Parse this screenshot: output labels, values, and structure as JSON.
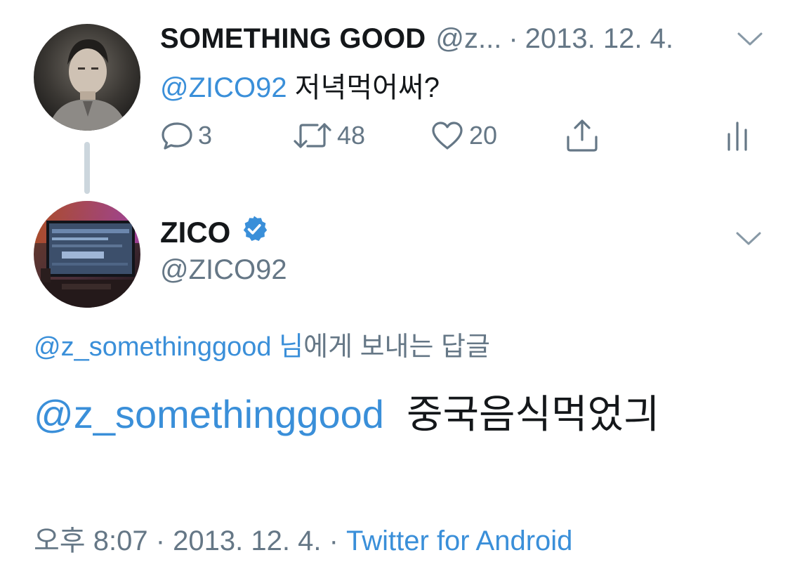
{
  "parent_tweet": {
    "author_name": "SOMETHING GOOD",
    "author_handle": "@z...",
    "separator": "·",
    "date": "2013. 12. 4.",
    "text_mention": "@ZICO92",
    "text_body": " 저녁먹어써?",
    "reply_count": "3",
    "retweet_count": "48",
    "like_count": "20"
  },
  "reply_tweet": {
    "author_name": "ZICO",
    "verified": true,
    "author_handle": "@ZICO92",
    "replying_to_handle": "@z_somethinggood",
    "replying_to_suffix": " 님",
    "replying_to_rest": "에게 보내는 답글",
    "text_mention": "@z_somethinggood",
    "text_body": "중국음식먹었긔",
    "time": "오후 8:07",
    "separator": "·",
    "date": "2013. 12. 4.",
    "source": "Twitter for Android"
  },
  "icons": {
    "reply": "reply-icon",
    "retweet": "retweet-icon",
    "like": "heart-icon",
    "share": "share-icon",
    "analytics": "analytics-icon",
    "more": "chevron-down-icon",
    "verified": "verified-badge-icon"
  },
  "colors": {
    "accent": "#3a8fd9",
    "secondary_text": "#657786",
    "primary_text": "#14171a",
    "thread_line": "#ccd6dd"
  }
}
